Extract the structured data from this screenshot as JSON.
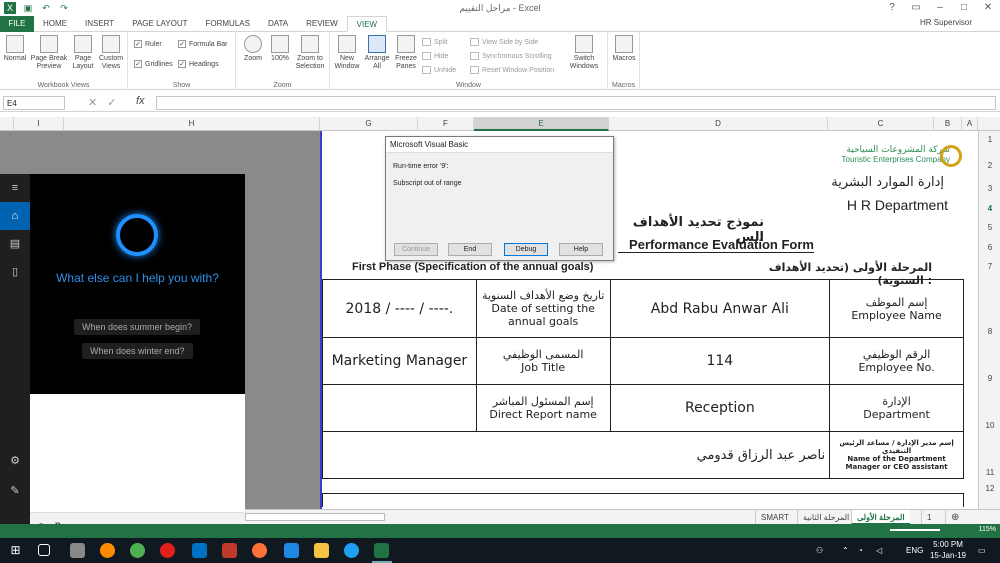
{
  "window": {
    "title": "مراحل التقييم - Excel",
    "user": "HR Supervisor"
  },
  "ribbon_tabs": [
    "FILE",
    "HOME",
    "INSERT",
    "PAGE LAYOUT",
    "FORMULAS",
    "DATA",
    "REVIEW",
    "VIEW"
  ],
  "active_tab": "VIEW",
  "ribbon": {
    "workbook_views": {
      "label": "Workbook Views",
      "normal": "Normal",
      "page_break": "Page Break Preview",
      "page_layout": "Page Layout",
      "custom_views": "Custom Views"
    },
    "show": {
      "label": "Show",
      "ruler": "Ruler",
      "formula_bar": "Formula Bar",
      "gridlines": "Gridlines",
      "headings": "Headings"
    },
    "zoom": {
      "label": "Zoom",
      "zoom": "Zoom",
      "z100": "100%",
      "zoom_sel": "Zoom to Selection"
    },
    "window": {
      "label": "Window",
      "new_window": "New Window",
      "arrange_all": "Arrange All",
      "freeze": "Freeze Panes",
      "split": "Split",
      "hide": "Hide",
      "unhide": "Unhide",
      "side_by_side": "View Side by Side",
      "sync": "Synchronous Scrolling",
      "reset": "Reset Window Position",
      "switch": "Switch Windows"
    },
    "macros": {
      "label": "Macros",
      "macros": "Macros"
    }
  },
  "formula_bar": {
    "name_box": "E4",
    "fx": "fx",
    "value": ""
  },
  "columns": [
    "I",
    "H",
    "G",
    "F",
    "E",
    "D",
    "C",
    "B",
    "A"
  ],
  "rows": [
    "1",
    "2",
    "3",
    "4",
    "5",
    "6",
    "7",
    "8",
    "9",
    "10",
    "11",
    "12"
  ],
  "selected_col": "E",
  "selected_row": "4",
  "cortana": {
    "question": "What else can I help you with?",
    "suggestions": [
      "When does summer begin?",
      "When does winter end?"
    ],
    "search_text": "p"
  },
  "dialog": {
    "title": "Microsoft Visual Basic",
    "error": "Run-time error '9':",
    "message": "Subscript out of range",
    "buttons": [
      "Continue",
      "End",
      "Debug",
      "Help"
    ]
  },
  "form": {
    "logo_ar": "شركة المشروعات السياحية",
    "logo_en": "Touristic Enterprises Company",
    "dept_ar": "إدارة الموارد البشرية",
    "dept_en": "H R Department",
    "title_ar": "نموذج تحديد الأهداف الس",
    "title_en": "Performance Evaluation Form",
    "phase_en": "First Phase (Specification of the annual goals)",
    "phase_ar": "المرحلة الأولى (تحديد الأهداف السنوية) :",
    "emp_name_ar": "إسم الموظف",
    "emp_name_en": "Employee Name",
    "emp_name": "Abd Rabu Anwar Ali",
    "date_ar": "تاريخ وضع الأهداف السنوية",
    "date_en": "Date of setting the annual goals",
    "date_val": "2018 / ---- / ----.",
    "emp_no_ar": "الرقم الوظيفي",
    "emp_no_en": "Employee No.",
    "emp_no": "114",
    "job_ar": "المسمى الوظيفي",
    "job_en": "Job Title",
    "job_val": "Marketing Manager",
    "dept2_ar": "الإدارة",
    "dept2_en": "Department",
    "dept2_val": "Reception",
    "direct_ar": "إسم المسئول المباشر",
    "direct_en": "Direct Report name",
    "mgr_ar": "إسم مدير الإدارة / مساعد الرئيس التنفيذي",
    "mgr_en": "Name of the Department Manager or CEO assistant",
    "mgr_val": "ناصر عبد الرزاق قدومي"
  },
  "sheet_tabs": [
    "SMART",
    "المرحلة الثانية",
    "المرحلة الأولى",
    "1"
  ],
  "active_sheet": "المرحلة الأولى",
  "status": {
    "zoom": "115%"
  },
  "taskbar": {
    "time": "5:00 PM",
    "date": "15-Jan-19",
    "lang": "ENG"
  },
  "colors": {
    "excel_green": "#217346",
    "cortana_blue": "#1e90ff",
    "accent": "#0078d7"
  }
}
